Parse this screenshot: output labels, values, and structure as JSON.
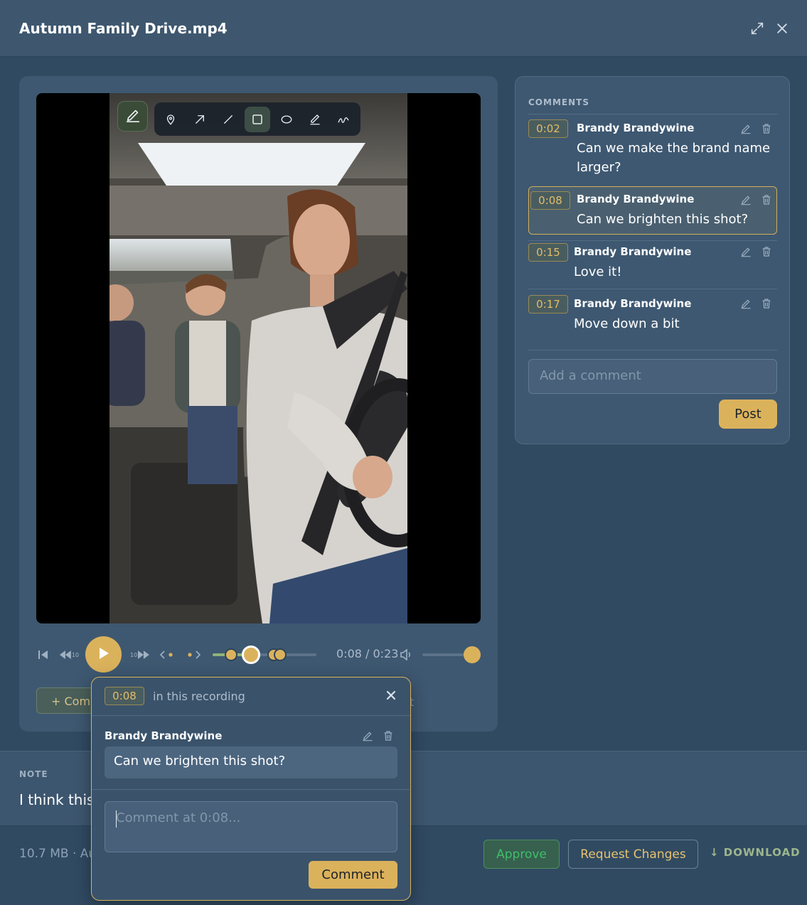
{
  "header": {
    "title": "Autumn Family Drive.mp4",
    "expand_icon": "expand-icon",
    "close_icon": "close-icon"
  },
  "video": {
    "tools": [
      {
        "name": "pin-tool",
        "icon": "map-pin-icon"
      },
      {
        "name": "arrow-tool",
        "icon": "arrow-icon"
      },
      {
        "name": "line-tool",
        "icon": "line-icon"
      },
      {
        "name": "rectangle-tool",
        "icon": "rectangle-icon",
        "active": true
      },
      {
        "name": "ellipse-tool",
        "icon": "ellipse-icon"
      },
      {
        "name": "pen-tool",
        "icon": "pen-icon"
      },
      {
        "name": "freehand-tool",
        "icon": "squiggle-icon"
      }
    ]
  },
  "controls": {
    "skip_back_label": "10",
    "skip_forward_label": "10",
    "timecode": "0:08 / 0:23",
    "current_seconds": 8,
    "duration_seconds": 23,
    "comment_markers_seconds": [
      2,
      8,
      15,
      17
    ],
    "volume": 1.0,
    "add_comment": "+ Com",
    "faded_trailing": "t"
  },
  "comments": {
    "title": "COMMENTS",
    "items": [
      {
        "time": "0:02",
        "author": "Brandy Brandywine",
        "text_line1": "Can we make the brand name",
        "text_line2": "larger?"
      },
      {
        "time": "0:08",
        "author": "Brandy Brandywine",
        "text": "Can we brighten this shot?"
      },
      {
        "time": "0:15",
        "author": "Brandy Brandywine",
        "text": "Love it!"
      },
      {
        "time": "0:17",
        "author": "Brandy Brandywine",
        "text": "Move down a bit"
      }
    ],
    "input_placeholder": "Add a comment",
    "post_label": "Post"
  },
  "note": {
    "label": "NOTE",
    "text": "I think this"
  },
  "footer": {
    "meta": "10.7 MB · Aug",
    "approve": "Approve",
    "request_changes": "Request Changes",
    "download": "↓ DOWNLOAD"
  },
  "popup": {
    "time": "0:08",
    "label": "in this recording",
    "author": "Brandy Brandywine",
    "comment": "Can we brighten this shot?",
    "placeholder": "Comment at 0:08...",
    "button": "Comment"
  },
  "colors": {
    "accent": "#dbb25c",
    "background": "#2f4a63",
    "card": "#3e5871",
    "approve_green": "#3fbf6b"
  }
}
